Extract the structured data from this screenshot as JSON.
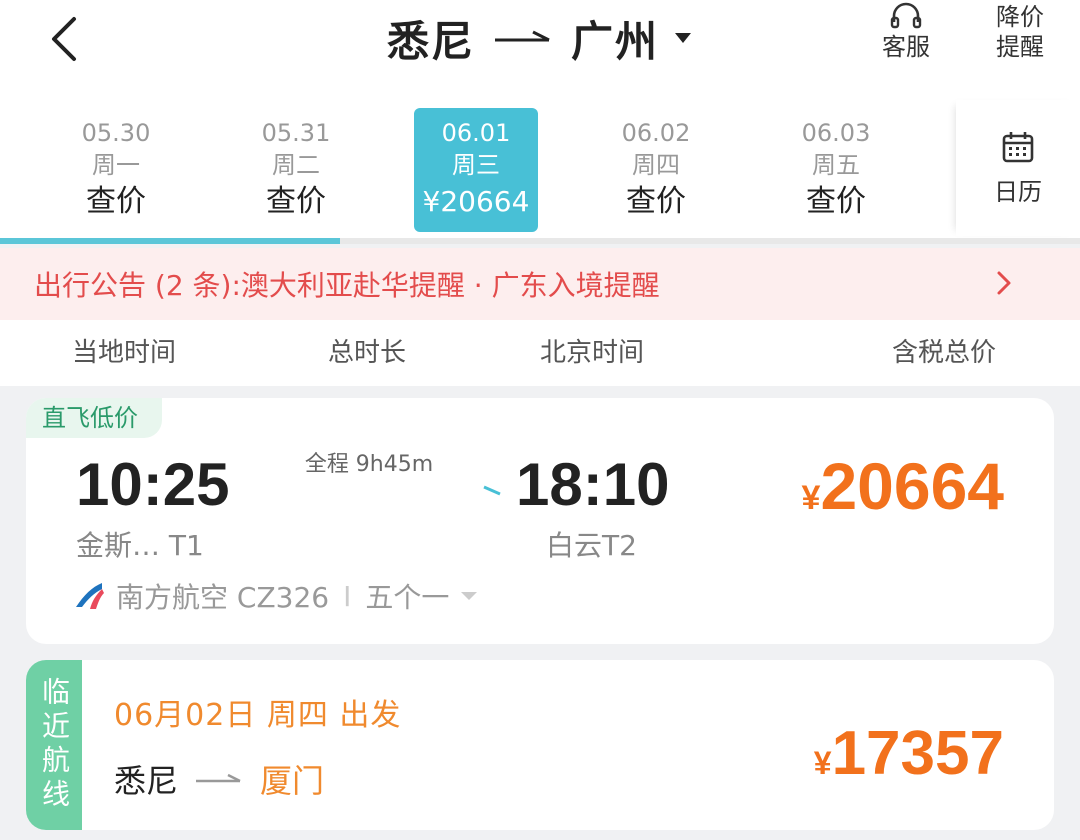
{
  "header": {
    "origin": "悉尼",
    "destination": "广州",
    "service_label": "客服",
    "price_alert_label": "降价\n提醒",
    "price_alert_line1": "降价",
    "price_alert_line2": "提醒"
  },
  "dates": [
    {
      "date": "05.30",
      "weekday": "周一",
      "price": "查价",
      "active": false
    },
    {
      "date": "05.31",
      "weekday": "周二",
      "price": "查价",
      "active": false
    },
    {
      "date": "06.01",
      "weekday": "周三",
      "price": "¥20664",
      "active": true
    },
    {
      "date": "06.02",
      "weekday": "周四",
      "price": "查价",
      "active": false
    },
    {
      "date": "06.03",
      "weekday": "周五",
      "price": "查价",
      "active": false
    }
  ],
  "calendar_label": "日历",
  "notice": {
    "text": "出行公告 (2 条):澳大利亚赴华提醒 · 广东入境提醒"
  },
  "sort_bar": {
    "local_time": "当地时间",
    "duration": "总时长",
    "beijing_time": "北京时间",
    "total_price": "含税总价"
  },
  "flight": {
    "tag": "直飞低价",
    "dep_time": "10:25",
    "dep_airport": "金斯… T1",
    "duration": "全程 9h45m",
    "arr_time": "18:10",
    "arr_airport": "白云T2",
    "currency": "¥",
    "price": "20664",
    "airline": "南方航空 CZ326",
    "separator": "I",
    "schedule": "五个一"
  },
  "nearby": {
    "tag": "临近航线",
    "date": "06月02日  周四  出发",
    "from": "悉尼",
    "to": "厦门",
    "currency": "¥",
    "price": "17357"
  },
  "colors": {
    "accent_teal": "#48c0d6",
    "price_orange": "#f2711c",
    "notice_red": "#e34c4c",
    "direct_green": "#2a9a6a",
    "nearby_tag_green": "#6fd0a5"
  },
  "icons": {
    "back": "chevron-left-icon",
    "service": "headset-icon",
    "calendar": "calendar-icon",
    "notice": "chevron-right-icon",
    "airline": "china-southern-logo-icon"
  }
}
